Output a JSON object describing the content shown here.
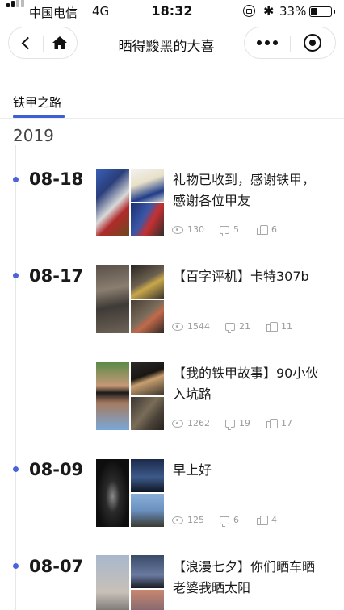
{
  "status_bar": {
    "carrier": "中国电信",
    "network": "4G",
    "time": "18:32",
    "battery_pct": "33%",
    "bluetooth_glyph": "✱",
    "battery_level": 0.33
  },
  "nav": {
    "title": "晒得黢黑的大喜",
    "back_icon": "chevron-left-icon",
    "home_icon": "home-icon",
    "more_icon": "more-dots-icon",
    "close_icon": "target-circle-icon"
  },
  "tabs": [
    {
      "label": "铁甲之路",
      "active": true
    }
  ],
  "accent_color": "#3d5fd6",
  "year": "2019",
  "posts": [
    {
      "date": "08-18",
      "title_lines": [
        "礼物已收到，感谢铁甲，",
        "感谢各位甲友"
      ],
      "views": "130",
      "comments": "5",
      "likes": "6"
    },
    {
      "date": "08-17",
      "title_lines": [
        "【百字评机】卡特307b"
      ],
      "views": "1544",
      "comments": "21",
      "likes": "11"
    },
    {
      "date": "",
      "title_lines": [
        "【我的铁甲故事】90小伙",
        "入坑路"
      ],
      "views": "1262",
      "comments": "19",
      "likes": "17"
    },
    {
      "date": "08-09",
      "title_lines": [
        "早上好"
      ],
      "views": "125",
      "comments": "6",
      "likes": "4"
    },
    {
      "date": "08-07",
      "title_lines": [
        "【浪漫七夕】你们晒车晒",
        "老婆我晒太阳"
      ],
      "views": "",
      "comments": "",
      "likes": ""
    }
  ]
}
